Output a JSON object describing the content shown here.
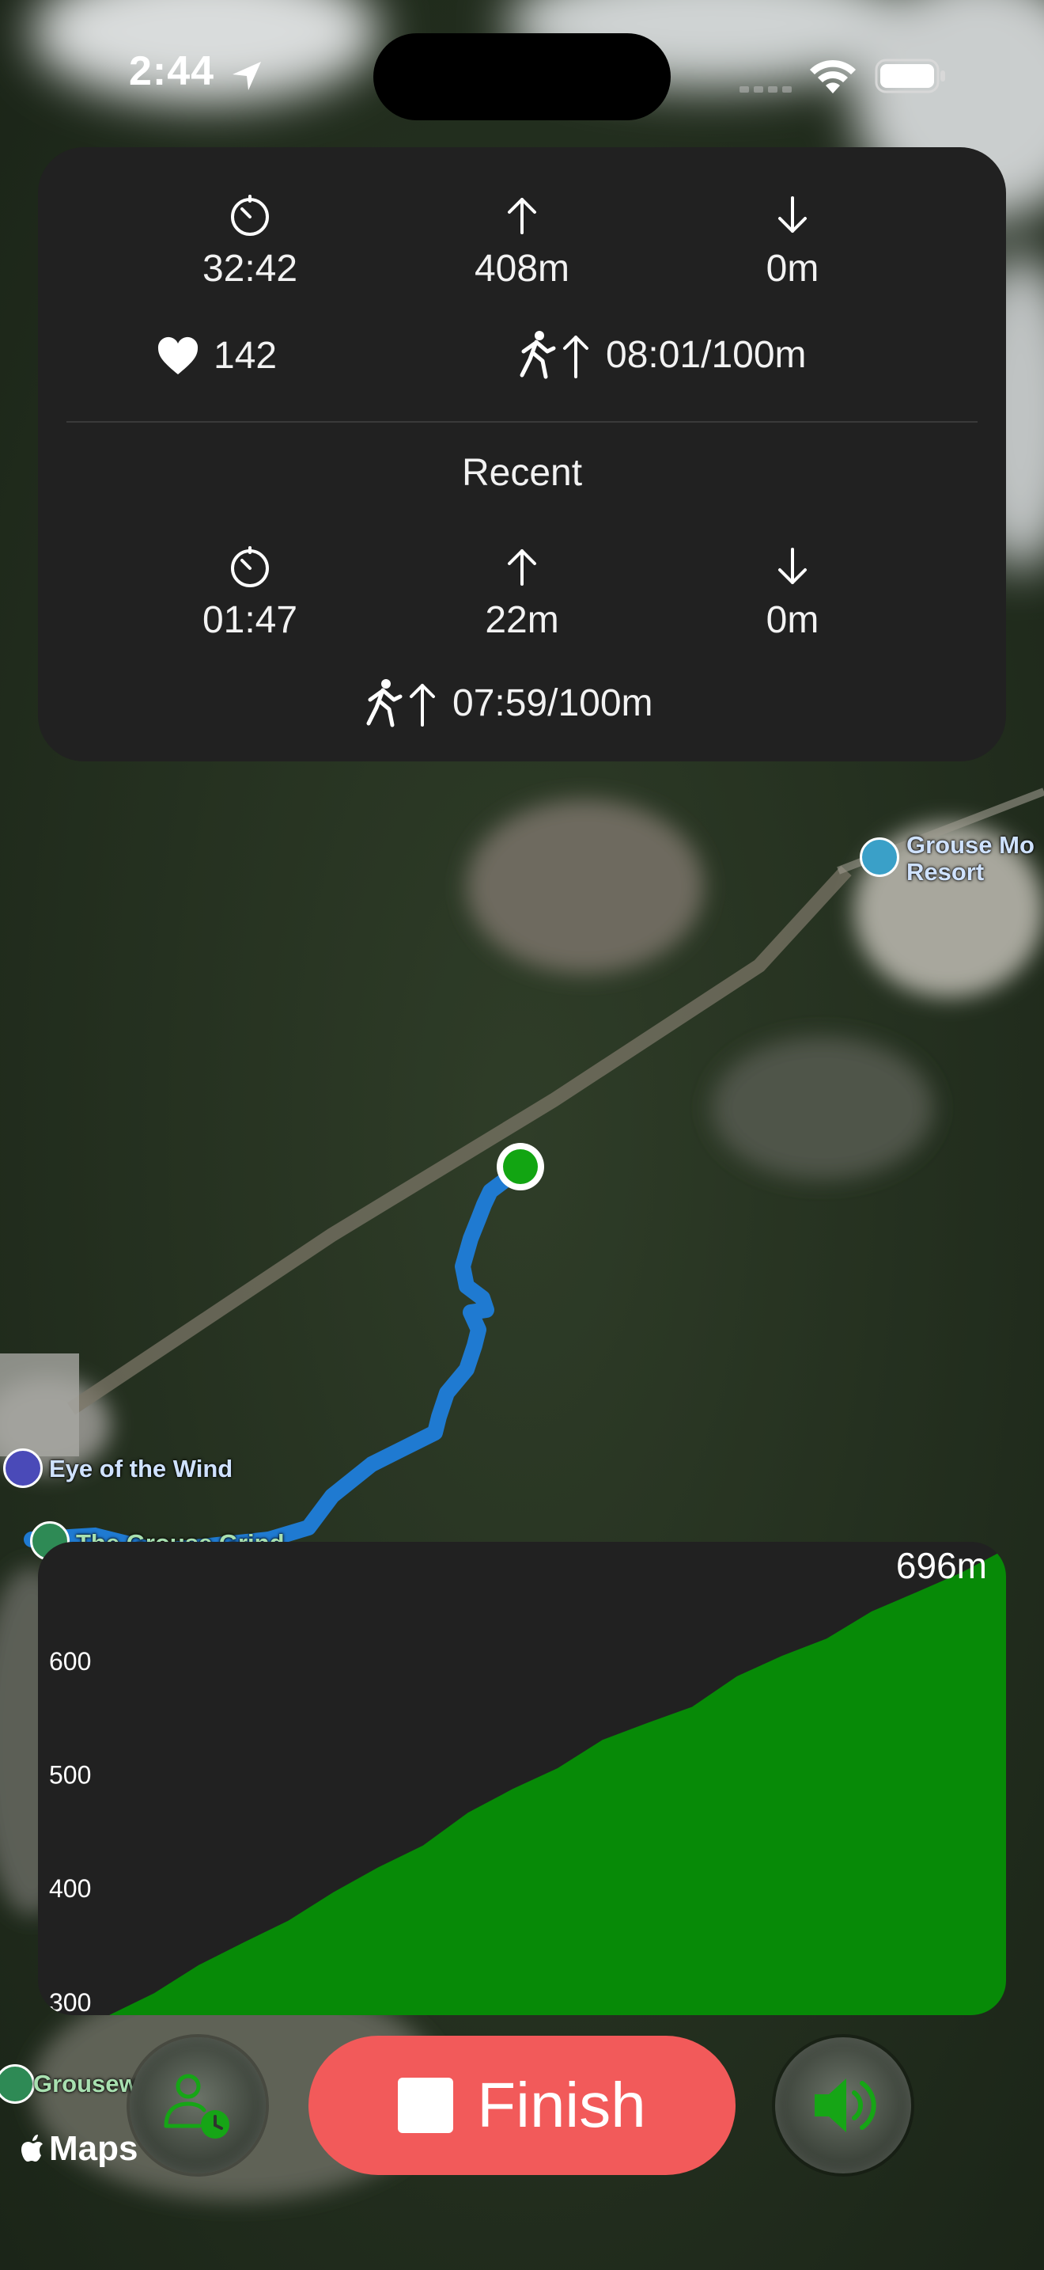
{
  "status": {
    "time": "2:44"
  },
  "stats": {
    "total": {
      "duration": "32:42",
      "ascent": "408m",
      "descent": "0m",
      "heart_rate": "142",
      "pace": "08:01/100m"
    },
    "recent_title": "Recent",
    "recent": {
      "duration": "01:47",
      "ascent": "22m",
      "descent": "0m",
      "pace": "07:59/100m"
    }
  },
  "map": {
    "labels": {
      "resort": [
        "Grouse Mo",
        "Resort"
      ],
      "eye_of_wind": "Eye of the Wind",
      "grouse_grind": "The Grouse Grind",
      "grousewoods": "Grousew"
    },
    "attribution": "Maps"
  },
  "chart_data": {
    "type": "area",
    "title": "",
    "xlabel": "",
    "ylabel": "",
    "current_label": "696m",
    "yticks": [
      600,
      500,
      400,
      300
    ],
    "ylim": [
      288,
      696
    ],
    "series": [
      {
        "x": [
          0,
          0.05,
          0.1,
          0.15,
          0.2,
          0.25,
          0.3,
          0.35,
          0.4,
          0.45,
          0.5,
          0.55,
          0.6,
          0.65,
          0.7,
          0.75,
          0.8,
          0.85,
          0.9,
          0.95,
          1.0
        ],
        "values": [
          288,
          310,
          330,
          352,
          374,
          394,
          418,
          440,
          464,
          487,
          508,
          528,
          545,
          562,
          584,
          604,
          622,
          641,
          660,
          680,
          696
        ]
      }
    ],
    "colors": {
      "fill": "#078a07",
      "background": "#212121"
    }
  },
  "controls": {
    "finish_label": "Finish"
  },
  "colors": {
    "route": "#1f7ad1",
    "current_position": "#12a512",
    "finish": "#f25a5a",
    "card": "#212121"
  },
  "icons": [
    "location-arrow-icon",
    "wifi-icon",
    "battery-icon",
    "timer-icon",
    "arrow-up-icon",
    "arrow-down-icon",
    "heart-icon",
    "hiker-up-icon",
    "person-clock-icon",
    "stop-icon",
    "speaker-icon",
    "apple-icon"
  ]
}
